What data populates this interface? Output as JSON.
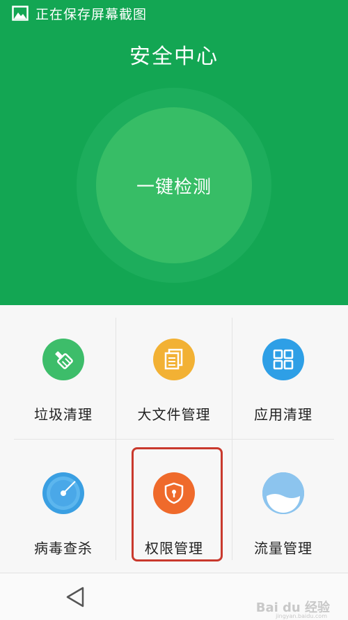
{
  "status_bar": {
    "text": "正在保存屏幕截图",
    "icon": "image-icon"
  },
  "header": {
    "title": "安全中心",
    "scan_button": "一键检测"
  },
  "colors": {
    "header_bg": "#13a653",
    "scan_circle": "#37bd66",
    "highlight_border": "#c9392d"
  },
  "tools": [
    {
      "label": "垃圾清理",
      "icon": "broom-icon",
      "color": "#3dbd6a"
    },
    {
      "label": "大文件管理",
      "icon": "document-icon",
      "color": "#f2b134"
    },
    {
      "label": "应用清理",
      "icon": "app-grid-icon",
      "color": "#2e9fe6"
    },
    {
      "label": "病毒查杀",
      "icon": "radar-icon",
      "color": "#3a9fe2"
    },
    {
      "label": "权限管理",
      "icon": "shield-lock-icon",
      "color": "#ef6a2b"
    },
    {
      "label": "流量管理",
      "icon": "data-bowl-icon",
      "color": "#79b9ea"
    }
  ],
  "navbar": {
    "back_icon": "back-triangle-icon"
  },
  "watermark": {
    "text": "Bai du 经验",
    "sub": "jingyan.baidu.com"
  }
}
